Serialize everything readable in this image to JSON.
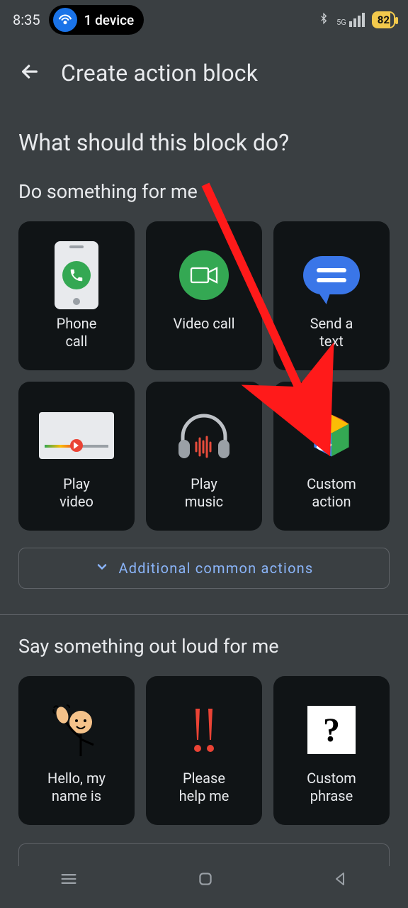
{
  "statusbar": {
    "time": "8:35",
    "device_badge": "1 device",
    "network_label": "5G",
    "battery_pct": "82"
  },
  "appbar": {
    "title": "Create action block"
  },
  "heading": "What should this block do?",
  "sections": {
    "do": {
      "title": "Do something for me",
      "tiles": [
        {
          "id": "phone-call",
          "label": "Phone\ncall"
        },
        {
          "id": "video-call",
          "label": "Video call"
        },
        {
          "id": "send-text",
          "label": "Send a\ntext"
        },
        {
          "id": "play-video",
          "label": "Play\nvideo"
        },
        {
          "id": "play-music",
          "label": "Play\nmusic"
        },
        {
          "id": "custom-action",
          "label": "Custom\naction"
        }
      ],
      "expand_label": "Additional common actions"
    },
    "say": {
      "title": "Say something out loud for me",
      "tiles": [
        {
          "id": "hello-name",
          "label": "Hello, my\nname is"
        },
        {
          "id": "help-me",
          "label": "Please\nhelp me"
        },
        {
          "id": "custom-phrase",
          "label": "Custom\nphrase"
        }
      ]
    }
  },
  "annotation": {
    "arrow_target_tile": "custom-action"
  }
}
